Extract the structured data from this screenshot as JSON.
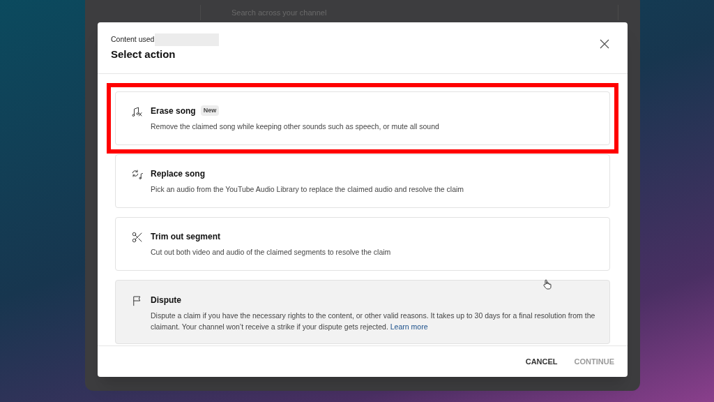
{
  "background_app": {
    "search_placeholder": "Search across your channel"
  },
  "dialog": {
    "label": "Content used",
    "title": "Select action"
  },
  "options": [
    {
      "kind": "erase",
      "title": "Erase song",
      "badge": "New",
      "description": "Remove the claimed song while keeping other sounds such as speech, or mute all sound",
      "highlighted": true,
      "hovered": false
    },
    {
      "kind": "replace",
      "title": "Replace song",
      "description": "Pick an audio from the YouTube Audio Library to replace the claimed audio and resolve the claim",
      "highlighted": false,
      "hovered": false
    },
    {
      "kind": "trim",
      "title": "Trim out segment",
      "description": "Cut out both video and audio of the claimed segments to resolve the claim",
      "highlighted": false,
      "hovered": false
    },
    {
      "kind": "dispute",
      "title": "Dispute",
      "description": "Dispute a claim if you have the necessary rights to the content, or other valid reasons. It takes up to 30 days for a final resolution from the claimant. Your channel won’t receive a strike if your dispute gets rejected.",
      "link": "Learn more",
      "highlighted": false,
      "hovered": true
    }
  ],
  "buttons": [
    {
      "label": "CANCEL",
      "disabled": false
    },
    {
      "label": "CONTINUE",
      "disabled": true
    }
  ]
}
